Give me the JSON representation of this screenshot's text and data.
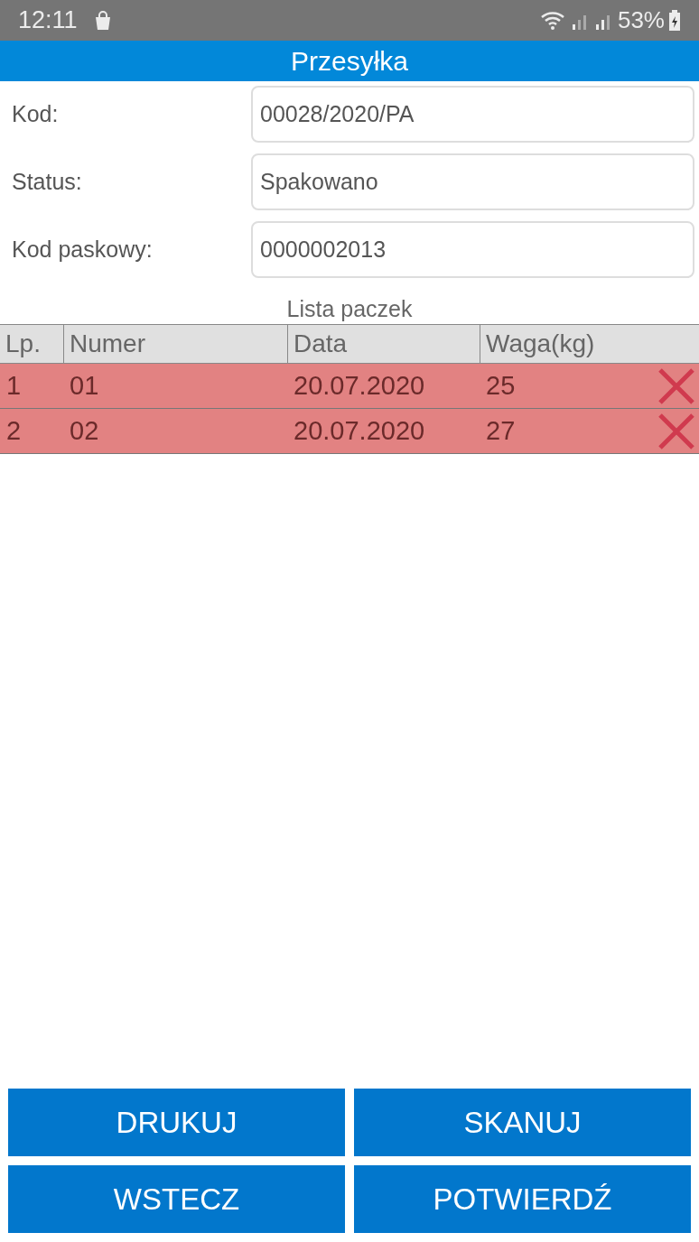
{
  "status_bar": {
    "time": "12:11",
    "battery": "53%"
  },
  "title": "Przesyłka",
  "fields": [
    {
      "label": "Kod:",
      "value": "00028/2020/PA"
    },
    {
      "label": "Status:",
      "value": "Spakowano"
    },
    {
      "label": "Kod paskowy:",
      "value": "0000002013"
    }
  ],
  "table": {
    "caption": "Lista paczek",
    "columns": [
      "Lp.",
      "Numer",
      "Data",
      "Waga(kg)"
    ],
    "rows": [
      {
        "cells": [
          "1",
          "01",
          "20.07.2020",
          "25"
        ]
      },
      {
        "cells": [
          "2",
          "02",
          "20.07.2020",
          "27"
        ]
      }
    ]
  },
  "buttons": [
    "DRUKUJ",
    "SKANUJ",
    "WSTECZ",
    "POTWIERDŹ"
  ]
}
